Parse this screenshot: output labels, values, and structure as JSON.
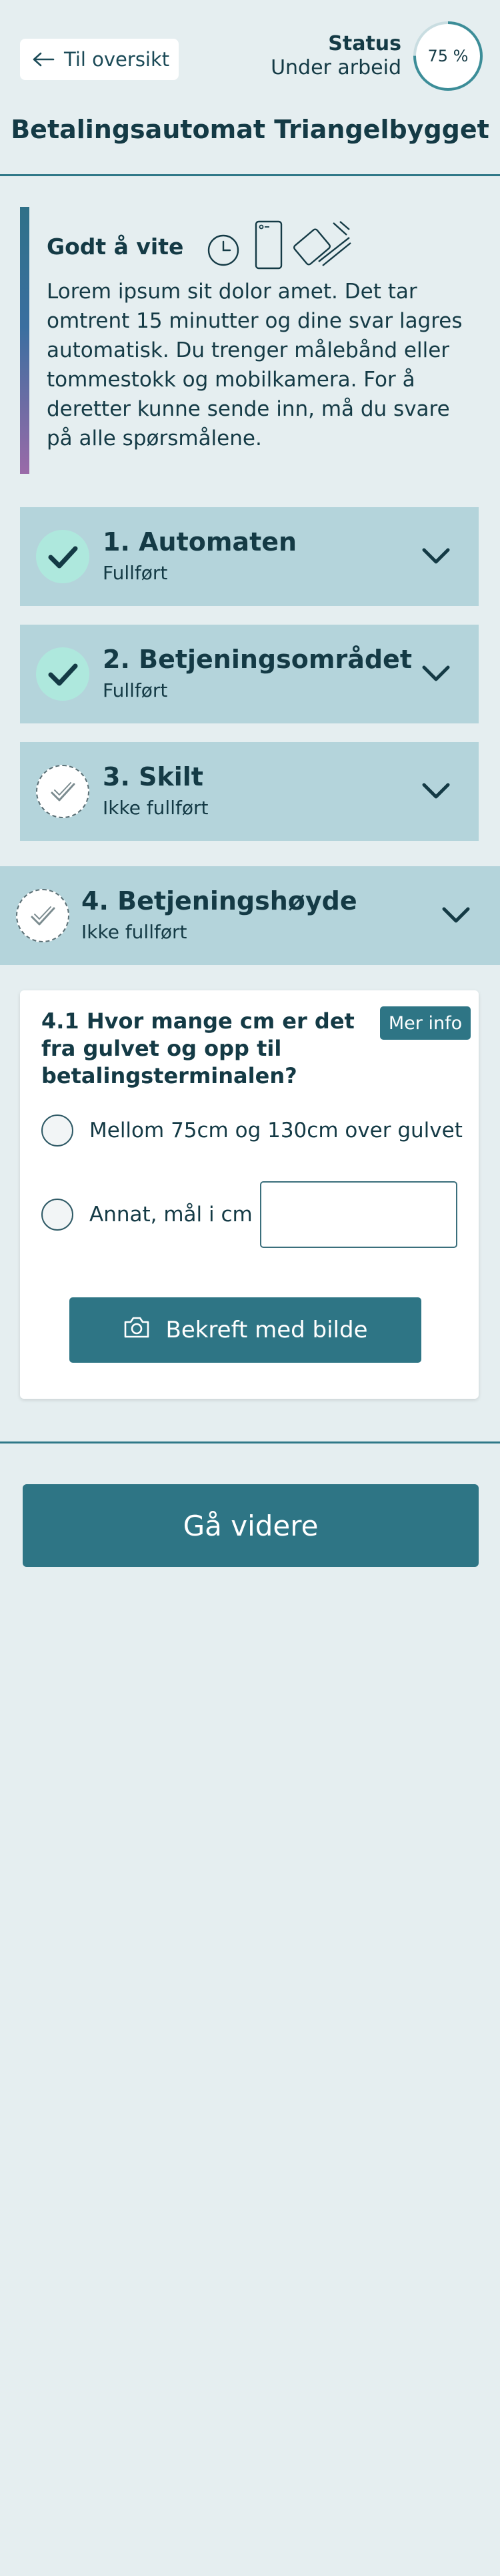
{
  "header": {
    "back_label": "Til oversikt",
    "status_label": "Status",
    "status_value": "Under arbeid",
    "progress_text": "75 %",
    "progress_fraction": 0.75,
    "title": "Betalingsautomat Triangelbygget"
  },
  "info": {
    "heading": "Godt å vite",
    "icons": [
      "clock-icon",
      "phone-icon",
      "tape-measure-icon"
    ],
    "text": "Lorem ipsum sit dolor amet. Det tar omtrent 15 minutter og dine svar lagres automatisk. Du trenger målebånd eller tommestokk og mobilkamera. For å deretter kunne sende inn, må du svare på alle spørsmålene."
  },
  "sections": [
    {
      "title": "1. Automaten",
      "status": "Fullført",
      "done": true
    },
    {
      "title": "2. Betjeningsområdet",
      "status": "Fullført",
      "done": true
    },
    {
      "title": "3. Skilt",
      "status": "Ikke fullført",
      "done": false
    },
    {
      "title": "4. Betjeningshøyde",
      "status": "Ikke fullført",
      "done": false,
      "expanded": true
    }
  ],
  "question": {
    "text": "4.1 Hvor mange cm er det fra gulvet og opp til betalingsterminalen?",
    "more_info_label": "Mer info",
    "options": [
      "Mellom 75cm og 130cm over gulvet",
      "Annat, mål i cm"
    ],
    "input_value": "",
    "photo_button_label": "Bekreft med bilde"
  },
  "footer": {
    "continue_label": "Gå videre"
  },
  "colors": {
    "background": "#e5eef0",
    "primary": "#2e7585",
    "section_bg": "#b4d4db",
    "done_badge": "#aee8dd",
    "text": "#143a45"
  }
}
